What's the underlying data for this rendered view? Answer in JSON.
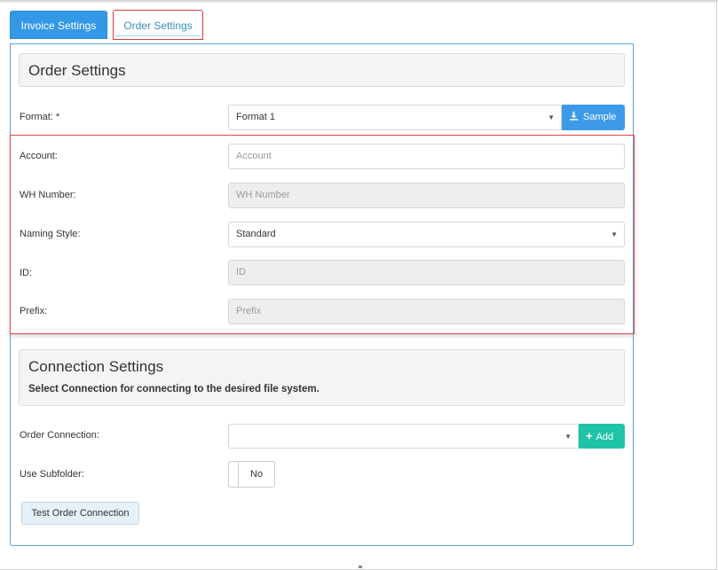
{
  "tabs": [
    {
      "label": "Invoice Settings",
      "active": false
    },
    {
      "label": "Order Settings",
      "active": true
    }
  ],
  "order_section": {
    "title": "Order Settings"
  },
  "format": {
    "label": "Format: *",
    "value": "Format 1",
    "sample_label": "Sample"
  },
  "account": {
    "label": "Account:",
    "placeholder": "Account"
  },
  "wh_number": {
    "label": "WH Number:",
    "placeholder": "WH Number"
  },
  "naming_style": {
    "label": "Naming Style:",
    "value": "Standard"
  },
  "id_field": {
    "label": "ID:",
    "placeholder": "ID"
  },
  "prefix": {
    "label": "Prefix:",
    "placeholder": "Prefix"
  },
  "connection_section": {
    "title": "Connection Settings",
    "subtitle": "Select Connection for connecting to the desired file system."
  },
  "order_connection": {
    "label": "Order Connection:",
    "value": "",
    "add_label": "Add"
  },
  "use_subfolder": {
    "label": "Use Subfolder:",
    "value": "No"
  },
  "test_button": {
    "label": "Test Order Connection"
  },
  "colors": {
    "primary": "#3399e6",
    "add_button": "#20c3a8",
    "highlight": "#e34848"
  }
}
